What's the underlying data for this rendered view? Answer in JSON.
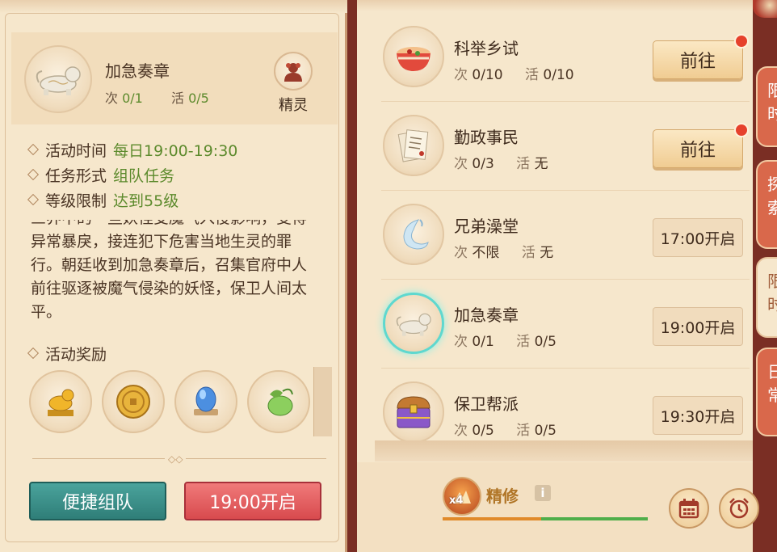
{
  "colors": {
    "parchment": "#f6e7cc",
    "green_value": "#5c8a2c",
    "teal_button": "#3a8f88",
    "red_button": "#dc5156",
    "gold_button": "#f0cc92",
    "selected_ring": "#5ed8cf"
  },
  "detail": {
    "title": "加急奏章",
    "count_label": "次",
    "count_value": "0/1",
    "active_label": "活",
    "active_value": "0/5",
    "spirit_label": "精灵",
    "info": [
      {
        "label": "活动时间",
        "value": "每日19:00-19:30"
      },
      {
        "label": "任务形式",
        "value": "组队任务"
      },
      {
        "label": "等级限制",
        "value": "达到55级"
      }
    ],
    "description": "三界中的一些妖怪受魔气入侵影响，变得异常暴戾，接连犯下危害当地生灵的罪行。朝廷收到加急奏章后，召集官府中人前往驱逐被魔气侵染的妖怪，保卫人间太平。",
    "rewards_label": "活动奖励",
    "rewards": [
      {
        "icon": "jade-beast-icon"
      },
      {
        "icon": "gold-coin-icon"
      },
      {
        "icon": "crystal-orb-icon"
      },
      {
        "icon": "green-pouch-icon"
      }
    ],
    "team_button": "便捷组队",
    "open_button": "19:00开启"
  },
  "activities": [
    {
      "name": "科举乡试",
      "count_label": "次",
      "count": "0/10",
      "active_label": "活",
      "active": "0/10",
      "action": "前往",
      "action_type": "go",
      "red_dot": true,
      "icon": "soup-bowl-icon",
      "selected": false
    },
    {
      "name": "勤政事民",
      "count_label": "次",
      "count": "0/3",
      "active_label": "活",
      "active": "无",
      "action": "前往",
      "action_type": "go",
      "red_dot": true,
      "icon": "document-scroll-icon",
      "selected": false
    },
    {
      "name": "兄弟澡堂",
      "count_label": "次",
      "count": "不限",
      "active_label": "活",
      "active": "无",
      "action": "17:00开启",
      "action_type": "time",
      "red_dot": false,
      "icon": "water-swirl-icon",
      "selected": false
    },
    {
      "name": "加急奏章",
      "count_label": "次",
      "count": "0/1",
      "active_label": "活",
      "active": "0/5",
      "action": "19:00开启",
      "action_type": "time",
      "red_dot": false,
      "icon": "jade-beast-icon",
      "selected": true
    },
    {
      "name": "保卫帮派",
      "count_label": "次",
      "count": "0/5",
      "active_label": "活",
      "active": "0/5",
      "action": "19:30开启",
      "action_type": "time",
      "red_dot": false,
      "icon": "treasure-chest-icon",
      "selected": false
    }
  ],
  "bottom": {
    "multiplier": "x4",
    "jingxiu_label": "精修",
    "info_glyph": "i",
    "progress": 0.48
  },
  "side_tabs": [
    {
      "label": "限时",
      "active": false
    },
    {
      "label": "探索",
      "active": false
    },
    {
      "label": "限时",
      "active": true
    },
    {
      "label": "日常",
      "active": false
    }
  ]
}
